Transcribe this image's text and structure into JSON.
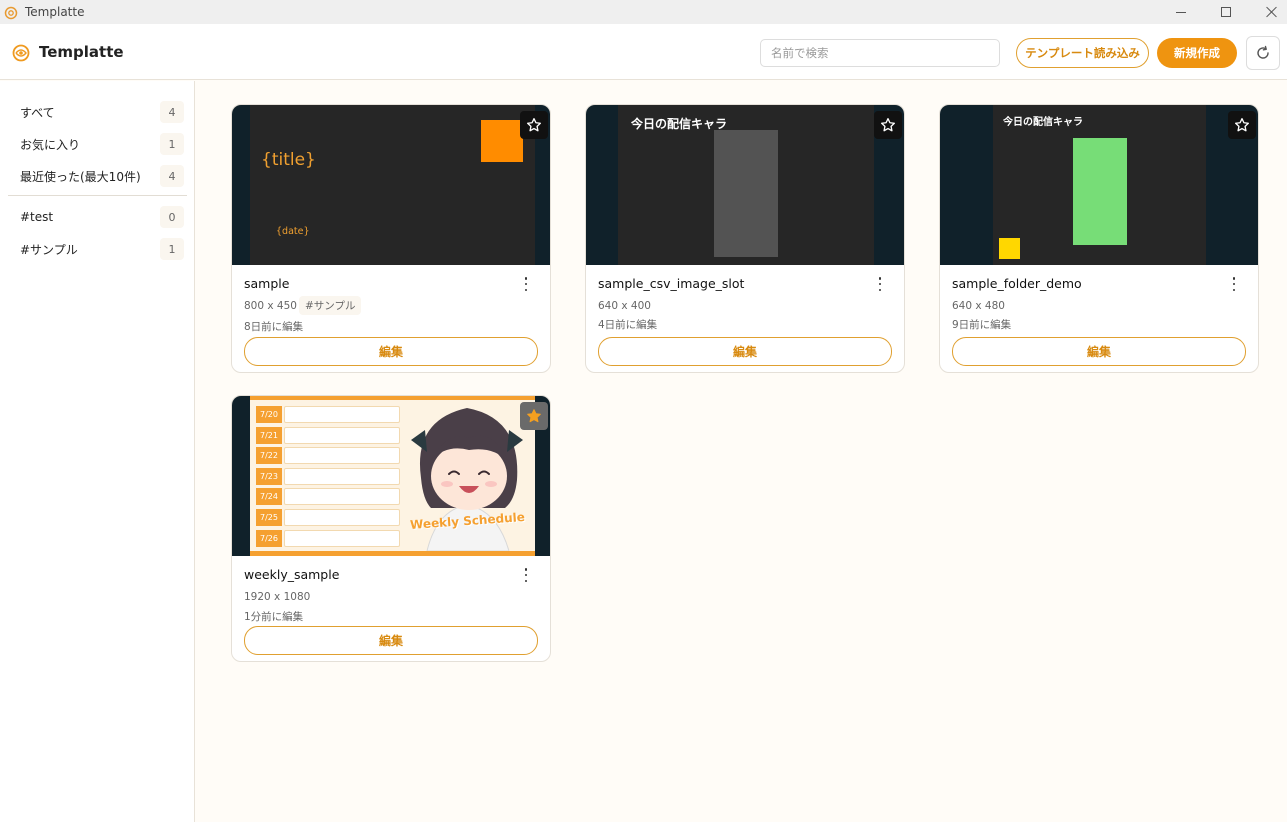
{
  "window": {
    "title": "Templatte"
  },
  "header": {
    "app_name": "Templatte",
    "search_placeholder": "名前で検索",
    "import_label": "テンプレート読み込み",
    "new_label": "新規作成"
  },
  "sidebar": {
    "items": [
      {
        "label": "すべて",
        "count": "4"
      },
      {
        "label": "お気に入り",
        "count": "1"
      },
      {
        "label": "最近使った(最大10件)",
        "count": "4"
      }
    ],
    "tags": [
      {
        "label": "#test",
        "count": "0"
      },
      {
        "label": "#サンプル",
        "count": "1"
      }
    ]
  },
  "templates": [
    {
      "name": "sample",
      "size": "800 x 450",
      "tag": "#サンプル",
      "edited": "8日前に編集",
      "favorite": false,
      "thumb_text": {
        "title": "{title}",
        "date": "{date}"
      }
    },
    {
      "name": "sample_csv_image_slot",
      "size": "640 x 400",
      "edited": "4日前に編集",
      "favorite": false,
      "thumb_text": {
        "heading": "今日の配信キャラ"
      }
    },
    {
      "name": "sample_folder_demo",
      "size": "640 x 480",
      "edited": "9日前に編集",
      "favorite": false,
      "thumb_text": {
        "heading": "今日の配信キャラ"
      }
    },
    {
      "name": "weekly_sample",
      "size": "1920 x 1080",
      "edited": "1分前に編集",
      "favorite": true,
      "thumb_text": {
        "dates": [
          "7/20",
          "7/21",
          "7/22",
          "7/23",
          "7/24",
          "7/25",
          "7/26"
        ],
        "banner": "Weekly Schedule"
      }
    }
  ],
  "edit_label": "編集",
  "colors": {
    "accent": "#ef9410",
    "accent_text": "#d88a10",
    "thumb_bg": "#10212a",
    "green_block": "#77dd77",
    "yellow_block": "#ffd700",
    "orange_block": "#ff8c00"
  },
  "icons": {
    "star": "star-outline-icon",
    "star_filled": "star-filled-icon",
    "more": "more-vertical-icon",
    "refresh": "refresh-icon"
  }
}
